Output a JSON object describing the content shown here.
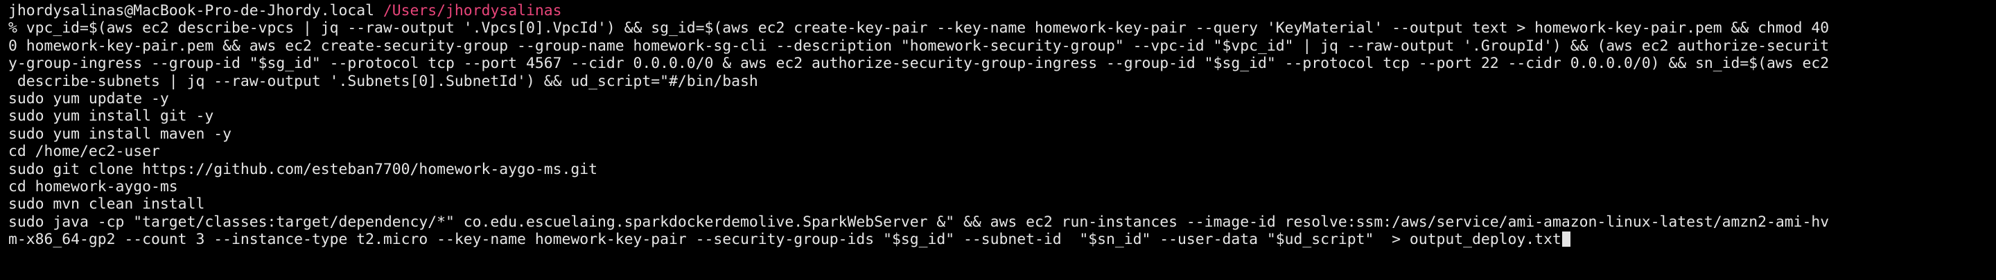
{
  "prompt": {
    "host": "jhordysalinas@MacBook-Pro-de-Jhordy.local",
    "path": "/Users/jhordysalinas"
  },
  "colors": {
    "background": "#000000",
    "text": "#e6e6e6",
    "path": "#e8457a",
    "cursor": "#e6e6e6"
  },
  "lines": [
    "% vpc_id=$(aws ec2 describe-vpcs | jq --raw-output '.Vpcs[0].VpcId') && sg_id=$(aws ec2 create-key-pair --key-name homework-key-pair --query 'KeyMaterial' --output text > homework-key-pair.pem && chmod 40",
    "0 homework-key-pair.pem && aws ec2 create-security-group --group-name homework-sg-cli --description \"homework-security-group\" --vpc-id \"$vpc_id\" | jq --raw-output '.GroupId') && (aws ec2 authorize-securit",
    "y-group-ingress --group-id \"$sg_id\" --protocol tcp --port 4567 --cidr 0.0.0.0/0 & aws ec2 authorize-security-group-ingress --group-id \"$sg_id\" --protocol tcp --port 22 --cidr 0.0.0.0/0) && sn_id=$(aws ec2",
    " describe-subnets | jq --raw-output '.Subnets[0].SubnetId') && ud_script=\"#/bin/bash",
    "sudo yum update -y",
    "sudo yum install git -y",
    "sudo yum install maven -y",
    "cd /home/ec2-user",
    "sudo git clone https://github.com/esteban7700/homework-aygo-ms.git",
    "cd homework-aygo-ms",
    "sudo mvn clean install",
    "sudo java -cp \"target/classes:target/dependency/*\" co.edu.escuelaing.sparkdockerdemolive.SparkWebServer &\" && aws ec2 run-instances --image-id resolve:ssm:/aws/service/ami-amazon-linux-latest/amzn2-ami-hv",
    "m-x86_64-gp2 --count 3 --instance-type t2.micro --key-name homework-key-pair --security-group-ids \"$sg_id\" --subnet-id  \"$sn_id\" --user-data \"$ud_script\"  > output_deploy.txt"
  ]
}
